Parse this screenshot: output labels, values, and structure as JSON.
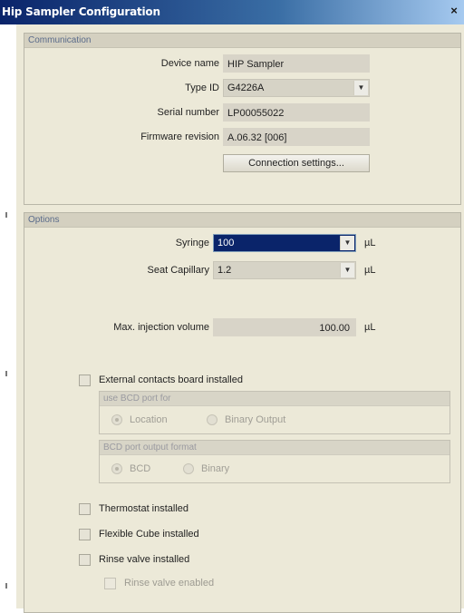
{
  "window": {
    "title": "Hip Sampler Configuration",
    "close_glyph": "×"
  },
  "communication": {
    "header": "Communication",
    "device_name": {
      "label": "Device name",
      "value": "HIP Sampler"
    },
    "type_id": {
      "label": "Type ID",
      "value": "G4226A"
    },
    "serial_number": {
      "label": "Serial number",
      "value": "LP00055022"
    },
    "firmware_revision": {
      "label": "Firmware revision",
      "value": "A.06.32 [006]"
    },
    "connection_settings_label": "Connection settings..."
  },
  "options": {
    "header": "Options",
    "syringe": {
      "label": "Syringe",
      "value": "100",
      "unit": "µL"
    },
    "seat_capillary": {
      "label": "Seat Capillary",
      "value": "1.2",
      "unit": "µL"
    },
    "max_injection_volume": {
      "label": "Max. injection volume",
      "value": "100.00",
      "unit": "µL"
    },
    "external_contacts": {
      "label": "External contacts board installed",
      "checked": false
    },
    "bcd_port_use": {
      "header": "use BCD port for",
      "options": [
        "Location",
        "Binary Output"
      ],
      "selected": "Location"
    },
    "bcd_port_format": {
      "header": "BCD port output format",
      "options": [
        "BCD",
        "Binary"
      ],
      "selected": "BCD"
    },
    "thermostat": {
      "label": "Thermostat installed",
      "checked": false
    },
    "flexible_cube": {
      "label": "Flexible Cube installed",
      "checked": false
    },
    "rinse_valve": {
      "label": "Rinse valve installed",
      "checked": false
    },
    "rinse_valve_enabled": {
      "label": "Rinse valve enabled",
      "checked": false
    }
  },
  "icons": {
    "dropdown": "chevron-down-icon",
    "close": "close-icon"
  },
  "colors": {
    "titlebar": "#0a246a",
    "selection": "#0a246a",
    "panel": "#ece9d8"
  }
}
